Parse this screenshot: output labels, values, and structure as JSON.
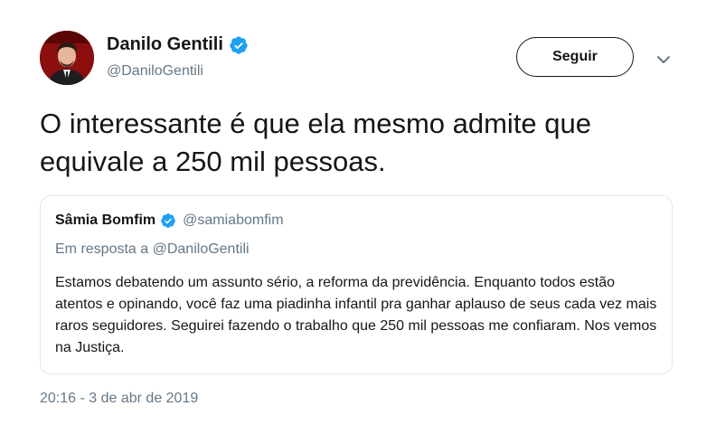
{
  "author": {
    "name": "Danilo Gentili",
    "handle": "@DaniloGentili",
    "verified": true,
    "avatar_icon": "avatar-photo"
  },
  "actions": {
    "follow_label": "Seguir",
    "menu_icon": "chevron-down-icon"
  },
  "tweet": {
    "text": "O interessante é que ela mesmo admite que equivale a 250 mil pessoas.",
    "timestamp": "20:16 - 3 de abr de 2019"
  },
  "quoted": {
    "name": "Sâmia Bomfim",
    "handle": "@samiabomfim",
    "verified": true,
    "reply_prefix": "Em resposta a",
    "reply_to": "@DaniloGentili",
    "text": "Estamos debatendo um assunto sério, a reforma da previdência. Enquanto todos estão atentos e opinando, você faz uma piadinha infantil pra ganhar aplauso de seus cada vez mais raros seguidores. Seguirei fazendo o trabalho que 250 mil pessoas me confiaram. Nos vemos na Justiça."
  },
  "colors": {
    "verified_blue": "#1da1f2",
    "secondary_text": "#657786",
    "border": "#e1e8ed"
  }
}
